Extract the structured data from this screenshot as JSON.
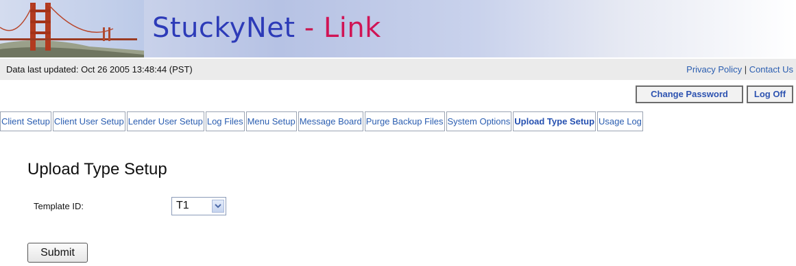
{
  "header": {
    "brand_main": "StuckyNet",
    "brand_dash": " - ",
    "brand_link": "Link",
    "bridge_image": "golden-gate-bridge"
  },
  "statusbar": {
    "updated_text": "Data last updated:  Oct 26 2005 13:48:44 (PST)",
    "privacy_label": "Privacy Policy",
    "separator": " | ",
    "contact_label": "Contact Us"
  },
  "actions": {
    "change_password": "Change Password",
    "log_off": "Log Off"
  },
  "tabs": [
    {
      "label": "Client Setup"
    },
    {
      "label": "Client User Setup"
    },
    {
      "label": "Lender User Setup"
    },
    {
      "label": "Log Files"
    },
    {
      "label": "Menu Setup"
    },
    {
      "label": "Message Board"
    },
    {
      "label": "Purge Backup Files"
    },
    {
      "label": "System Options"
    },
    {
      "label": "Upload Type Setup",
      "active": true
    },
    {
      "label": "Usage Log"
    }
  ],
  "main": {
    "title": "Upload Type Setup",
    "template_label": "Template ID:",
    "template_value": "T1",
    "submit_label": "Submit"
  },
  "colors": {
    "link": "#2a5db0",
    "brand_blue": "#2d3bb8",
    "brand_pink": "#d01455"
  }
}
